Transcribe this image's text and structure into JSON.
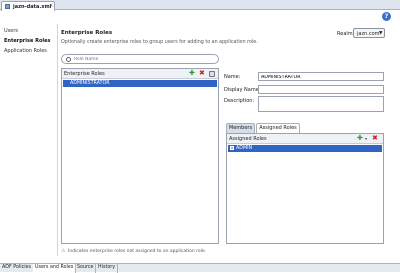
{
  "editor": {
    "file_tab": "jazn-data.xml",
    "help": "?"
  },
  "sidebar": {
    "items": [
      {
        "label": "Users"
      },
      {
        "label": "Enterprise Roles"
      },
      {
        "label": "Application Roles"
      }
    ]
  },
  "main": {
    "title": "Enterprise Roles",
    "subtitle": "Optionally create enterprise roles to group users for adding to an application role.",
    "realm_label": "Realm:",
    "realm_value": "jazn.com"
  },
  "search": {
    "placeholder": "Role Name"
  },
  "roles_panel": {
    "header": "Enterprise Roles",
    "rows": [
      {
        "label": "ADMINISTRATOR"
      }
    ]
  },
  "details": {
    "name_label": "Name:",
    "name_value": "ADMINISTRATOR",
    "display_name_label": "Display Name:",
    "display_name_value": "",
    "description_label": "Description:",
    "description_value": ""
  },
  "sub_tabs": [
    {
      "label": "Members"
    },
    {
      "label": "Assigned Roles"
    }
  ],
  "assigned_panel": {
    "header": "Assigned Roles",
    "rows": [
      {
        "label": "ADMIN"
      }
    ]
  },
  "footnote": "Indicates enterprise roles not assigned to an application role.",
  "bottom_tabs": [
    {
      "label": "ADF Policies"
    },
    {
      "label": "Users and Roles"
    },
    {
      "label": "Source"
    },
    {
      "label": "History"
    }
  ],
  "colors": {
    "selection": "#2f63c4",
    "add": "#2c9a2c",
    "delete": "#d01c1c"
  }
}
